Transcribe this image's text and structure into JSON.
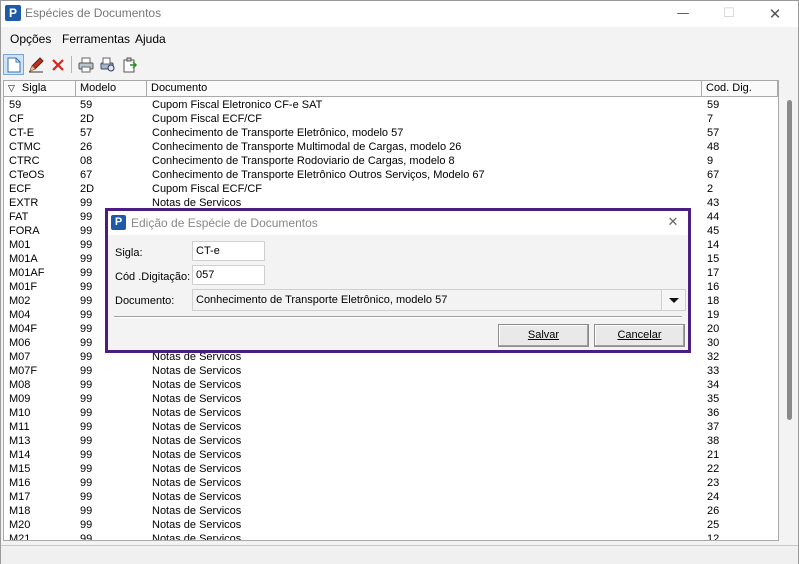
{
  "window": {
    "title": "Espécies de Documentos",
    "minimize": "—",
    "maximize": "☐",
    "close": "✕"
  },
  "app_icon": "P",
  "menu": [
    "Opções",
    "Ferramentas",
    "Ajuda"
  ],
  "toolbar": {
    "icons": [
      "new-document-icon",
      "edit-icon",
      "delete-icon",
      "print-icon",
      "print-preview-icon",
      "export-icon"
    ]
  },
  "grid": {
    "sort_indicator": "▽",
    "columns": [
      "Sigla",
      "Modelo",
      "Documento",
      "Cod. Dig."
    ],
    "rows": [
      [
        "59",
        "59",
        "Cupom Fiscal Eletronico CF-e SAT",
        "59"
      ],
      [
        "CF",
        "2D",
        "Cupom Fiscal ECF/CF",
        "7"
      ],
      [
        "CT-E",
        "57",
        "Conhecimento de Transporte Eletrônico, modelo 57",
        "57"
      ],
      [
        "CTMC",
        "26",
        "Conhecimento de Transporte Multimodal de Cargas, modelo 26",
        "48"
      ],
      [
        "CTRC",
        "08",
        "Conhecimento de Transporte Rodoviario de Cargas, modelo 8",
        "9"
      ],
      [
        "CTeOS",
        "67",
        "Conhecimento de Transporte Eletrônico Outros Serviços, Modelo 67",
        "67"
      ],
      [
        "ECF",
        "2D",
        "Cupom Fiscal ECF/CF",
        "2"
      ],
      [
        "EXTR",
        "99",
        "Notas de Servicos",
        "43"
      ],
      [
        "FAT",
        "99",
        "",
        "44"
      ],
      [
        "FORA",
        "99",
        "",
        "45"
      ],
      [
        "M01",
        "99",
        "",
        "14"
      ],
      [
        "M01A",
        "99",
        "",
        "15"
      ],
      [
        "M01AF",
        "99",
        "",
        "17"
      ],
      [
        "M01F",
        "99",
        "",
        "16"
      ],
      [
        "M02",
        "99",
        "",
        "18"
      ],
      [
        "M04",
        "99",
        "",
        "19"
      ],
      [
        "M04F",
        "99",
        "",
        "20"
      ],
      [
        "M06",
        "99",
        "",
        "30"
      ],
      [
        "M07",
        "99",
        "Notas de Servicos",
        "32"
      ],
      [
        "M07F",
        "99",
        "Notas de Servicos",
        "33"
      ],
      [
        "M08",
        "99",
        "Notas de Servicos",
        "34"
      ],
      [
        "M09",
        "99",
        "Notas de Servicos",
        "35"
      ],
      [
        "M10",
        "99",
        "Notas de Servicos",
        "36"
      ],
      [
        "M11",
        "99",
        "Notas de Servicos",
        "37"
      ],
      [
        "M13",
        "99",
        "Notas de Servicos",
        "38"
      ],
      [
        "M14",
        "99",
        "Notas de Servicos",
        "21"
      ],
      [
        "M15",
        "99",
        "Notas de Servicos",
        "22"
      ],
      [
        "M16",
        "99",
        "Notas de Servicos",
        "23"
      ],
      [
        "M17",
        "99",
        "Notas de Servicos",
        "24"
      ],
      [
        "M18",
        "99",
        "Notas de Servicos",
        "26"
      ],
      [
        "M20",
        "99",
        "Notas de Servicos",
        "25"
      ],
      [
        "M21",
        "99",
        "Notas de Servicos",
        "12"
      ]
    ]
  },
  "dialog": {
    "title": "Edição de Espécie de Documentos",
    "close": "✕",
    "sigla_label": "Sigla:",
    "sigla_value": "CT-e",
    "cod_label": "Cód .Digitação:",
    "cod_value": "057",
    "documento_label": "Documento:",
    "documento_value": "Conhecimento de Transporte Eletrônico, modelo 57",
    "save_label": "Salvar",
    "cancel_label": "Cancelar"
  },
  "colors": {
    "dialog_border": "#4b1c82",
    "brand": "#1f5aa8",
    "delete": "#d9261c"
  }
}
